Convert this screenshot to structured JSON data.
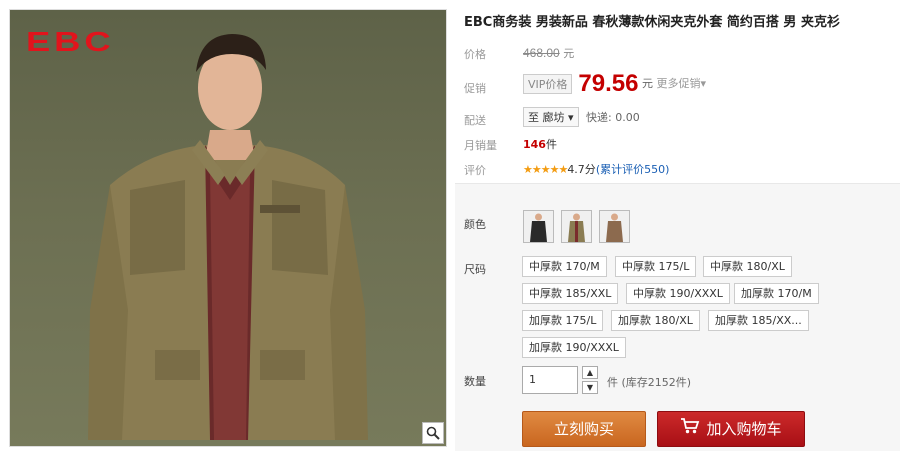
{
  "brand": "EBC",
  "title": "EBC商务装 男装新品 春秋薄款休闲夹克外套 简约百搭 男 夹克衫",
  "price": {
    "label": "价格",
    "original": "468.00",
    "currency": "元"
  },
  "promo": {
    "label": "促销",
    "tag": "VIP价格",
    "price": "79.56",
    "currency": "元",
    "more": "更多促销"
  },
  "delivery": {
    "label": "配送",
    "to": "至 廊坊",
    "shipping": "快递: 0.00"
  },
  "sales": {
    "label": "月销量",
    "count": "146",
    "unit": "件"
  },
  "rating": {
    "label": "评价",
    "stars": "★★★★★",
    "score": "4.7分",
    "reviews": "(累计评价550)"
  },
  "options": {
    "color_label": "颜色",
    "size_label": "尺码",
    "sizes": [
      "中厚款 170/M",
      "中厚款 175/L",
      "中厚款 180/XL",
      "中厚款 185/XXL",
      "中厚款 190/XXXL",
      "加厚款 170/M",
      "加厚款 175/L",
      "加厚款 180/XL",
      "加厚款 185/XX...",
      "加厚款 190/XXXL"
    ],
    "qty_label": "数量",
    "qty_value": "1",
    "qty_unit": "件",
    "stock": "(库存2152件)"
  },
  "buttons": {
    "buy": "立刻购买",
    "cart": "加入购物车"
  },
  "colors": {
    "price_red": "#c40000",
    "buy_btn": "#d4762e",
    "cart_btn": "#b8151c"
  }
}
